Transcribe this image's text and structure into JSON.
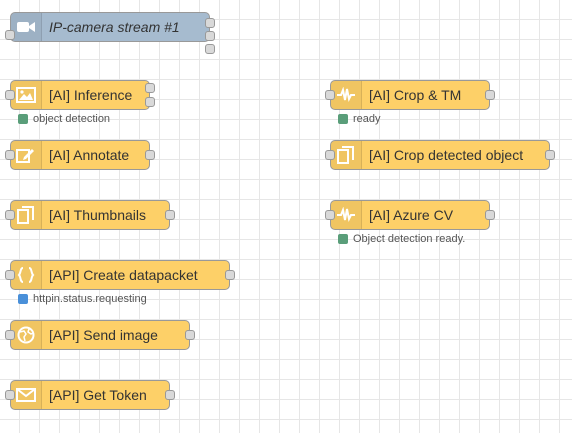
{
  "nodes": {
    "ip_camera": {
      "label": "IP-camera stream #1",
      "icon": "video-camera-icon",
      "color": "#a6bbcf"
    },
    "ai_inference": {
      "label": "[AI] Inference",
      "icon": "image-icon",
      "color": "#fdd068",
      "status": {
        "text": "object detection",
        "color": "#5a9e7a"
      }
    },
    "ai_crop_tm": {
      "label": "[AI] Crop & TM",
      "icon": "waveform-icon",
      "color": "#fdd068",
      "status": {
        "text": "ready",
        "color": "#5a9e7a"
      }
    },
    "ai_annotate": {
      "label": "[AI] Annotate",
      "icon": "edit-icon",
      "color": "#fdd068"
    },
    "ai_crop_detected": {
      "label": "[AI] Crop detected object",
      "icon": "copy-icon",
      "color": "#fdd068"
    },
    "ai_thumbnails": {
      "label": "[AI] Thumbnails",
      "icon": "copy-icon",
      "color": "#fdd068"
    },
    "ai_azure_cv": {
      "label": "[AI] Azure CV",
      "icon": "waveform-icon",
      "color": "#fdd068",
      "status": {
        "text": "Object detection ready.",
        "color": "#5a9e7a"
      }
    },
    "api_create_datapacket": {
      "label": "[API] Create datapacket",
      "icon": "curly-braces-icon",
      "color": "#fdd068",
      "status": {
        "text": "httpin.status.requesting",
        "color": "#4a90d9"
      }
    },
    "api_send_image": {
      "label": "[API] Send image",
      "icon": "globe-icon",
      "color": "#fdd068"
    },
    "api_get_token": {
      "label": "[API] Get Token",
      "icon": "envelope-icon",
      "color": "#fdd068"
    }
  }
}
